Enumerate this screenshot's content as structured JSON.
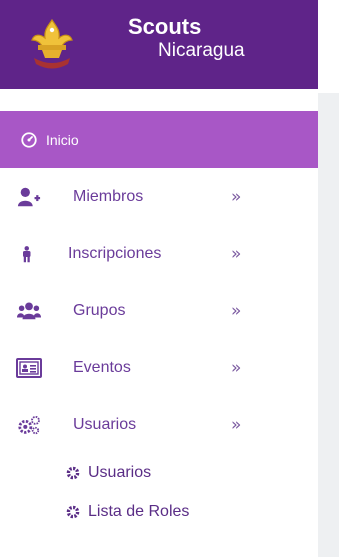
{
  "brand": {
    "line1": "Scouts",
    "line2": "Nicaragua",
    "bg_color": "#5f2489"
  },
  "nav": {
    "items": [
      {
        "label": "Inicio",
        "icon": "dashboard-icon",
        "active": true
      },
      {
        "label": "Miembros",
        "icon": "user-plus-icon",
        "chevron": "»"
      },
      {
        "label": "Inscripciones",
        "icon": "child-icon",
        "chevron": "»"
      },
      {
        "label": "Grupos",
        "icon": "users-icon",
        "chevron": "»"
      },
      {
        "label": "Eventos",
        "icon": "id-card-icon",
        "chevron": "»"
      },
      {
        "label": "Usuarios",
        "icon": "cogs-icon",
        "chevron": "»"
      }
    ],
    "subitems": [
      {
        "label": "Usuarios",
        "icon": "gear-icon"
      },
      {
        "label": "Lista de Roles",
        "icon": "gear-icon"
      }
    ]
  },
  "colors": {
    "active_bg": "#a857c6",
    "text": "#6a3b9a"
  }
}
